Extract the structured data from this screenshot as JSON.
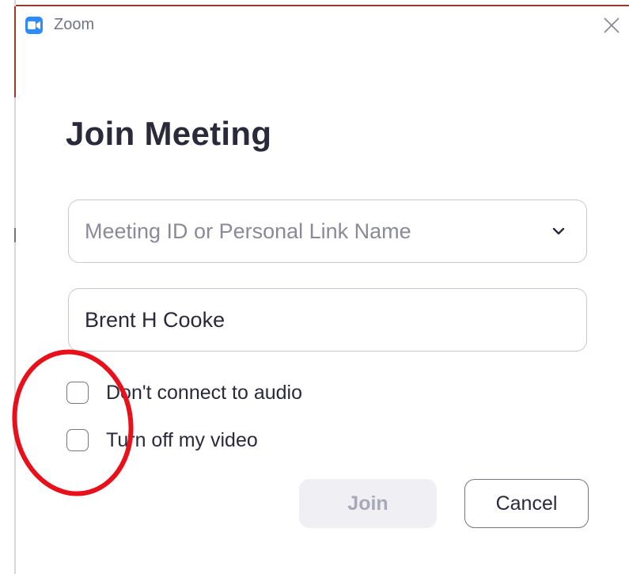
{
  "window": {
    "app_name": "Zoom",
    "app_icon": "zoom-camera-icon",
    "close_icon": "close-icon"
  },
  "dialog": {
    "heading": "Join Meeting",
    "meeting_id_field": {
      "value": "",
      "placeholder": "Meeting ID or Personal Link Name",
      "dropdown_icon": "chevron-down-icon"
    },
    "name_field": {
      "value": "Brent H Cooke",
      "placeholder": ""
    },
    "options": [
      {
        "label": "Don't connect to audio",
        "checked": false
      },
      {
        "label": "Turn off my video",
        "checked": false
      }
    ],
    "buttons": {
      "join_label": "Join",
      "cancel_label": "Cancel"
    }
  },
  "annotation": {
    "shape": "ellipse",
    "color": "#e8101a",
    "encircles": "checkboxes"
  },
  "colors": {
    "brand_blue": "#2d8cff",
    "text_dark": "#2a2a3a",
    "muted": "#747487",
    "annotation_red": "#e8101a"
  }
}
